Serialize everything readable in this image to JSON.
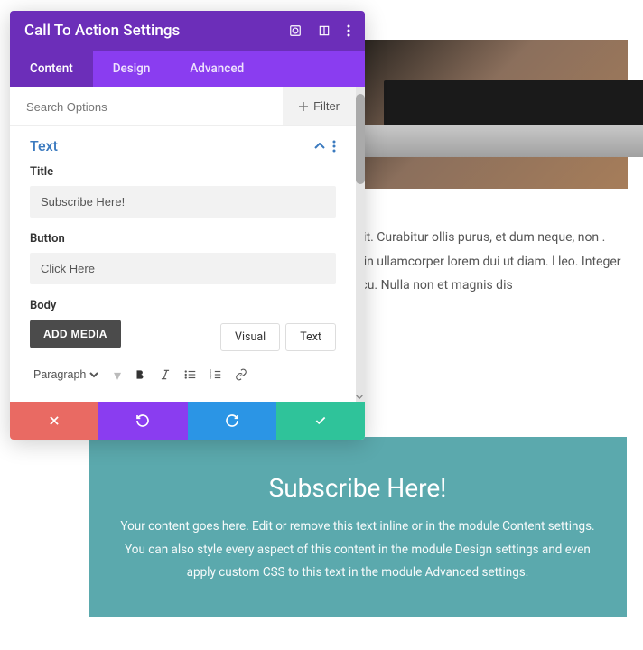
{
  "modal": {
    "title": "Call To Action Settings",
    "tabs": [
      "Content",
      "Design",
      "Advanced"
    ],
    "active_tab": 0,
    "search_placeholder": "Search Options",
    "filter_label": "Filter",
    "section": {
      "title": "Text",
      "fields": {
        "title_label": "Title",
        "title_value": "Subscribe Here!",
        "button_label": "Button",
        "button_value": "Click Here",
        "body_label": "Body",
        "add_media_label": "ADD MEDIA"
      },
      "editor_tabs": [
        "Visual",
        "Text"
      ],
      "toolbar_format": "Paragraph"
    }
  },
  "background_text": "g elit. Curabitur ollis purus, et dum neque, non . est in ullamcorper  lorem dui ut diam. l leo. Integer id rcu. Nulla non et magnis dis",
  "cta_preview": {
    "heading": "Subscribe Here!",
    "body": "Your content goes here. Edit or remove this text inline or in the module Content settings. You can also style every aspect of this content in the module Design settings and even apply custom CSS to this text in the module Advanced settings."
  },
  "colors": {
    "purple_dark": "#6c2eb9",
    "purple": "#8a3df0",
    "red": "#e96a63",
    "blue": "#2b95e5",
    "green": "#2fc39a",
    "teal": "#5ba9ad",
    "link_blue": "#3b7abf"
  }
}
